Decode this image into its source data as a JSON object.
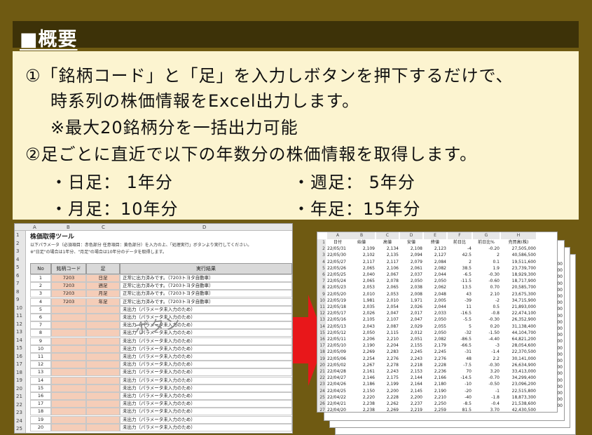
{
  "title": "■概要",
  "lines": {
    "l1": "①「銘柄コード」と「足」を入力しボタンを押下するだけで、",
    "l2": "時系列の株価情報をExcel出力します。",
    "l3": "※最大20銘柄分を一括出力可能",
    "l4": "②足ごとに直近で以下の年数分の株価情報を取得します。",
    "b1": "・日足： 1年分",
    "b2": "・週足： 5年分",
    "b3": "・月足：10年分",
    "b4": "・年足：15年分"
  },
  "sheet": {
    "columns": [
      "A",
      "B",
      "C",
      "D"
    ],
    "tool_title": "株価取得ツール",
    "desc1": "以下パラメータ（必須項目：赤色部分 任意項目：黄色部分）を入力の上、「処理実行」ボタンより実行してください。",
    "desc2": "※\"日足\"の場合は1年分、\"月足\"の場合は10年分のデータを取得します。",
    "headers": {
      "no": "No",
      "code": "銘柄コード",
      "leg": "足",
      "result": "実行結果"
    },
    "rows": [
      {
        "no": "1",
        "code": "7203",
        "leg": "日足",
        "result": "正常に出力済みです。（7203トヨタ自動車）"
      },
      {
        "no": "2",
        "code": "7203",
        "leg": "週足",
        "result": "正常に出力済みです。（7203トヨタ自動車）"
      },
      {
        "no": "3",
        "code": "7203",
        "leg": "月足",
        "result": "正常に出力済みです。（7203トヨタ自動車）"
      },
      {
        "no": "4",
        "code": "7203",
        "leg": "年足",
        "result": "正常に出力済みです。（7203トヨタ自動車）"
      },
      {
        "no": "5",
        "code": "",
        "leg": "",
        "result": "未出力（パラメータ未入力のため）"
      },
      {
        "no": "6",
        "code": "",
        "leg": "",
        "result": "未出力（パラメータ未入力のため）"
      },
      {
        "no": "7",
        "code": "",
        "leg": "",
        "result": "未出力（パラメータ未入力のため）"
      },
      {
        "no": "8",
        "code": "",
        "leg": "",
        "result": "未出力（パラメータ未入力のため）"
      },
      {
        "no": "9",
        "code": "",
        "leg": "",
        "result": "未出力（パラメータ未入力のため）"
      },
      {
        "no": "10",
        "code": "",
        "leg": "",
        "result": "未出力（パラメータ未入力のため）"
      },
      {
        "no": "11",
        "code": "",
        "leg": "",
        "result": "未出力（パラメータ未入力のため）"
      },
      {
        "no": "12",
        "code": "",
        "leg": "",
        "result": "未出力（パラメータ未入力のため）"
      },
      {
        "no": "13",
        "code": "",
        "leg": "",
        "result": "未出力（パラメータ未入力のため）"
      },
      {
        "no": "14",
        "code": "",
        "leg": "",
        "result": "未出力（パラメータ未入力のため）"
      },
      {
        "no": "15",
        "code": "",
        "leg": "",
        "result": "未出力（パラメータ未入力のため）"
      },
      {
        "no": "16",
        "code": "",
        "leg": "",
        "result": "未出力（パラメータ未入力のため）"
      },
      {
        "no": "17",
        "code": "",
        "leg": "",
        "result": "未出力（パラメータ未入力のため）"
      },
      {
        "no": "18",
        "code": "",
        "leg": "",
        "result": "未出力（パラメータ未入力のため）"
      },
      {
        "no": "19",
        "code": "",
        "leg": "",
        "result": "未出力（パラメータ未入力のため）"
      },
      {
        "no": "20",
        "code": "",
        "leg": "",
        "result": "未出力（パラメータ未入力のため）"
      }
    ],
    "stamp": "ボタン"
  },
  "data_sheet": {
    "columns": [
      "A",
      "B",
      "C",
      "D",
      "E",
      "F",
      "G",
      "H"
    ],
    "headers": [
      "日付",
      "始値",
      "高値",
      "安値",
      "終値",
      "前日比",
      "前日比%",
      "売買高(株)"
    ],
    "rows": [
      [
        "22/05/31",
        "2,109",
        "2,134",
        "2,108",
        "2,123",
        "-4",
        "-0.20",
        "27,505,000"
      ],
      [
        "22/05/30",
        "2,102",
        "2,135",
        "2,094",
        "2,127",
        "42.5",
        "2",
        "40,586,500"
      ],
      [
        "22/05/27",
        "2,117",
        "2,117",
        "2,079",
        "2,084",
        "2",
        "0.1",
        "19,511,600"
      ],
      [
        "22/05/26",
        "2,065",
        "2,106",
        "2,061",
        "2,082",
        "38.5",
        "1.9",
        "23,739,700"
      ],
      [
        "22/05/25",
        "2,040",
        "2,067",
        "2,037",
        "2,044",
        "-6.5",
        "-0.30",
        "18,929,300"
      ],
      [
        "22/05/24",
        "2,065",
        "2,078",
        "2,050",
        "2,050",
        "-11.5",
        "-0.60",
        "18,717,900"
      ],
      [
        "22/05/23",
        "2,053",
        "2,065",
        "2,038",
        "2,062",
        "13.5",
        "0.70",
        "20,585,700"
      ],
      [
        "22/05/20",
        "2,010",
        "2,053",
        "2,008",
        "2,048",
        "43",
        "2.10",
        "23,675,300"
      ],
      [
        "22/05/19",
        "1,981",
        "2,010",
        "1,971",
        "2,005",
        "-39",
        "-2",
        "34,715,900"
      ],
      [
        "22/05/18",
        "2,035",
        "2,054",
        "2,026",
        "2,044",
        "11",
        "0.5",
        "21,893,000"
      ],
      [
        "22/05/17",
        "2,026",
        "2,047",
        "2,017",
        "2,033",
        "-16.5",
        "-0.8",
        "22,474,100"
      ],
      [
        "22/05/16",
        "2,105",
        "2,107",
        "2,047",
        "2,050",
        "-5.5",
        "-0.30",
        "26,352,900"
      ],
      [
        "22/05/13",
        "2,043",
        "2,087",
        "2,029",
        "2,055",
        "5",
        "0.20",
        "31,138,400"
      ],
      [
        "22/05/12",
        "2,050",
        "2,115",
        "2,012",
        "2,050",
        "-32",
        "-1.50",
        "44,104,700"
      ],
      [
        "22/05/11",
        "2,206",
        "2,210",
        "2,051",
        "2,082",
        "-86.5",
        "-4.40",
        "64,821,200"
      ],
      [
        "22/05/10",
        "2,190",
        "2,204",
        "2,155",
        "2,179",
        "-66.5",
        "-3",
        "28,054,600"
      ],
      [
        "22/05/09",
        "2,269",
        "2,283",
        "2,245",
        "2,245",
        "-31",
        "-1.4",
        "22,370,500"
      ],
      [
        "22/05/06",
        "2,254",
        "2,276",
        "2,243",
        "2,276",
        "48",
        "2.2",
        "30,141,000"
      ],
      [
        "22/05/02",
        "2,267",
        "2,278",
        "2,218",
        "2,228",
        "-7.5",
        "-0.30",
        "26,634,900"
      ],
      [
        "22/04/28",
        "2,161",
        "2,243",
        "2,153",
        "2,236",
        "70",
        "3.20",
        "33,413,000"
      ],
      [
        "22/04/27",
        "2,146",
        "2,175",
        "2,144",
        "2,166",
        "-14.5",
        "-0.70",
        "34,299,400"
      ],
      [
        "22/04/26",
        "2,186",
        "2,199",
        "2,164",
        "2,180",
        "-10",
        "-0.50",
        "23,096,200"
      ],
      [
        "22/04/25",
        "2,150",
        "2,200",
        "2,145",
        "2,190",
        "-20",
        "-1",
        "22,515,800"
      ],
      [
        "22/04/22",
        "2,220",
        "2,228",
        "2,200",
        "2,210",
        "-40",
        "-1.8",
        "18,873,300"
      ],
      [
        "22/04/21",
        "2,238",
        "2,262",
        "2,237",
        "2,250",
        "-8.5",
        "-0.4",
        "21,538,600"
      ],
      [
        "22/04/20",
        "2,238",
        "2,269",
        "2,219",
        "2,259",
        "81.5",
        "3.70",
        "42,430,500"
      ]
    ],
    "side_vals": [
      "300",
      "000",
      "700",
      "600",
      "300",
      "200",
      "700",
      "200",
      "300",
      "000",
      "400",
      "800",
      "500",
      "900",
      "000",
      "700",
      "000",
      "400",
      "800",
      "400",
      "800",
      "300",
      "700"
    ]
  }
}
